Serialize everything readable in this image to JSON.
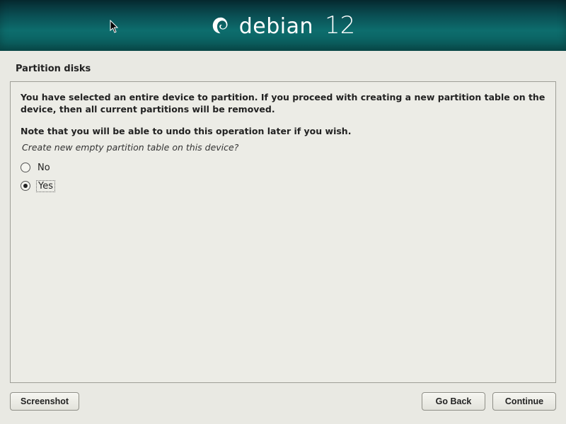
{
  "header": {
    "product": "debian",
    "version": "12"
  },
  "title": "Partition disks",
  "message1": "You have selected an entire device to partition. If you proceed with creating a new partition table on the device, then all current partitions will be removed.",
  "message2": "Note that you will be able to undo this operation later if you wish.",
  "question": "Create new empty partition table on this device?",
  "options": {
    "no": "No",
    "yes": "Yes",
    "selected": "yes"
  },
  "buttons": {
    "screenshot": "Screenshot",
    "goback": "Go Back",
    "continue": "Continue"
  }
}
